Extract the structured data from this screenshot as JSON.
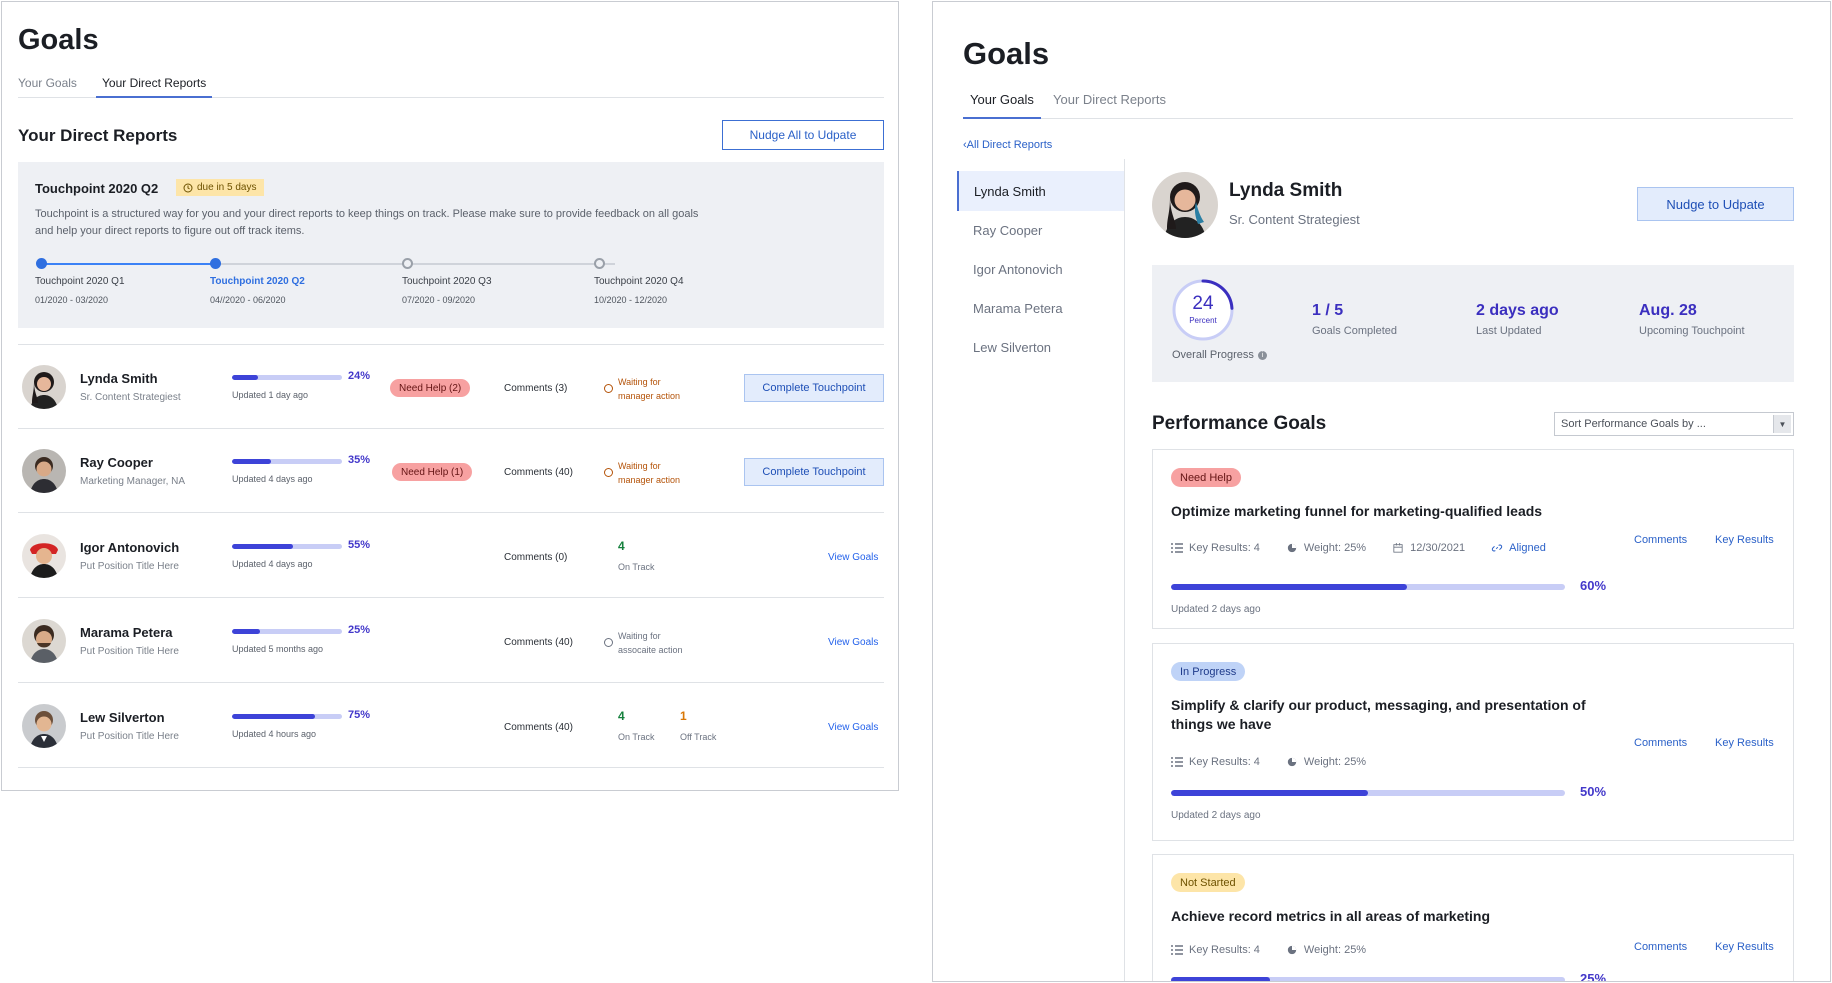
{
  "left": {
    "title": "Goals",
    "tabs": [
      "Your Goals",
      "Your Direct Reports"
    ],
    "section_title": "Your Direct Reports",
    "nudge_all_label": "Nudge All to Udpate",
    "touchpoint": {
      "title": "Touchpoint 2020 Q2",
      "due_label": "due in 5 days",
      "description": "Touchpoint is a structured way for you and your direct reports to keep things on track. Please make sure to provide feedback on all goals and help your direct reports to figure out off track items.",
      "stops": [
        {
          "label": "Touchpoint 2020 Q1",
          "dates": "01/2020 - 03/2020"
        },
        {
          "label": "Touchpoint 2020 Q2",
          "dates": "04//2020 -  06/2020"
        },
        {
          "label": "Touchpoint 2020 Q3",
          "dates": "07/2020 - 09/2020"
        },
        {
          "label": "Touchpoint 2020 Q4",
          "dates": "10/2020 - 12/2020"
        }
      ]
    },
    "reports": [
      {
        "name": "Lynda Smith",
        "title": "Sr. Content Strategiest",
        "pct": "24%",
        "progress": 0.24,
        "updated": "Updated 1 day ago",
        "help": "Need Help (2)",
        "comments": "Comments (3)",
        "wait_1": "Waiting for",
        "wait_2": "manager action",
        "action": "Complete Touchpoint"
      },
      {
        "name": "Ray Cooper",
        "title": "Marketing Manager, NA",
        "pct": "35%",
        "progress": 0.35,
        "updated": "Updated 4 days ago",
        "help": "Need Help (1)",
        "comments": "Comments (40)",
        "wait_1": "Waiting for",
        "wait_2": "manager action",
        "action": "Complete Touchpoint"
      },
      {
        "name": "Igor Antonovich",
        "title": "Put Position Title Here",
        "pct": "55%",
        "progress": 0.55,
        "updated": "Updated 4 days ago",
        "comments": "Comments (0)",
        "on_track_num": "4",
        "on_track_lbl": "On Track",
        "action": "View Goals"
      },
      {
        "name": "Marama Petera",
        "title": "Put Position Title Here",
        "pct": "25%",
        "progress": 0.25,
        "updated": "Updated 5 months ago",
        "comments": "Comments (40)",
        "wait_1": "Waiting for",
        "wait_2": "assocaite action",
        "action": "View Goals"
      },
      {
        "name": "Lew Silverton",
        "title": "Put Position Title Here",
        "pct": "75%",
        "progress": 0.75,
        "updated": "Updated 4 hours ago",
        "comments": "Comments (40)",
        "on_track_num": "4",
        "on_track_lbl": "On Track",
        "off_track_num": "1",
        "off_track_lbl": "Off Track",
        "action": "View Goals"
      }
    ]
  },
  "right": {
    "title": "Goals",
    "tabs": [
      "Your Goals",
      "Your Direct Reports"
    ],
    "back_link": "All Direct Reports",
    "people": [
      "Lynda Smith",
      "Ray Cooper",
      "Igor Antonovich",
      "Marama Petera",
      "Lew Silverton"
    ],
    "profile": {
      "name": "Lynda Smith",
      "title": "Sr. Content Strategiest",
      "nudge_label": "Nudge to Udpate"
    },
    "summary": {
      "overall_value": "24",
      "overall_progress": 0.24,
      "overall_unit": "Percent",
      "overall_caption": "Overall Progress",
      "metrics": [
        {
          "value": "1 / 5",
          "label": "Goals Completed"
        },
        {
          "value": "2 days ago",
          "label": "Last Updated"
        },
        {
          "value": "Aug. 28",
          "label": "Upcoming Touchpoint"
        }
      ]
    },
    "performance_title": "Performance Goals",
    "sort_placeholder": "Sort Performance Goals by ...",
    "goals": [
      {
        "status": "Need Help",
        "title": "Optimize marketing funnel for marketing-qualified leads",
        "key_results": "Key Results: 4",
        "weight": "Weight: 25%",
        "date": "12/30/2021",
        "aligned": "Aligned",
        "comments": "Comments",
        "key_results_link": "Key Results",
        "pct": "60%",
        "progress": 0.6,
        "updated": "Updated 2 days ago"
      },
      {
        "status": "In Progress",
        "title": "Simplify & clarify our product, messaging, and presentation of things we have",
        "key_results": "Key Results: 4",
        "weight": "Weight: 25%",
        "comments": "Comments",
        "key_results_link": "Key Results",
        "pct": "50%",
        "progress": 0.5,
        "updated": "Updated 2 days ago"
      },
      {
        "status": "Not Started",
        "title": "Achieve record metrics in all areas of marketing",
        "key_results": "Key Results: 4",
        "weight": "Weight: 25%",
        "comments": "Comments",
        "key_results_link": "Key Results",
        "pct": "25%",
        "progress": 0.25
      }
    ],
    "status_colors": {
      "Need Help": "#f7a1a1",
      "In Progress": "#bfd3f7",
      "Not Started": "#fde5a8"
    }
  }
}
